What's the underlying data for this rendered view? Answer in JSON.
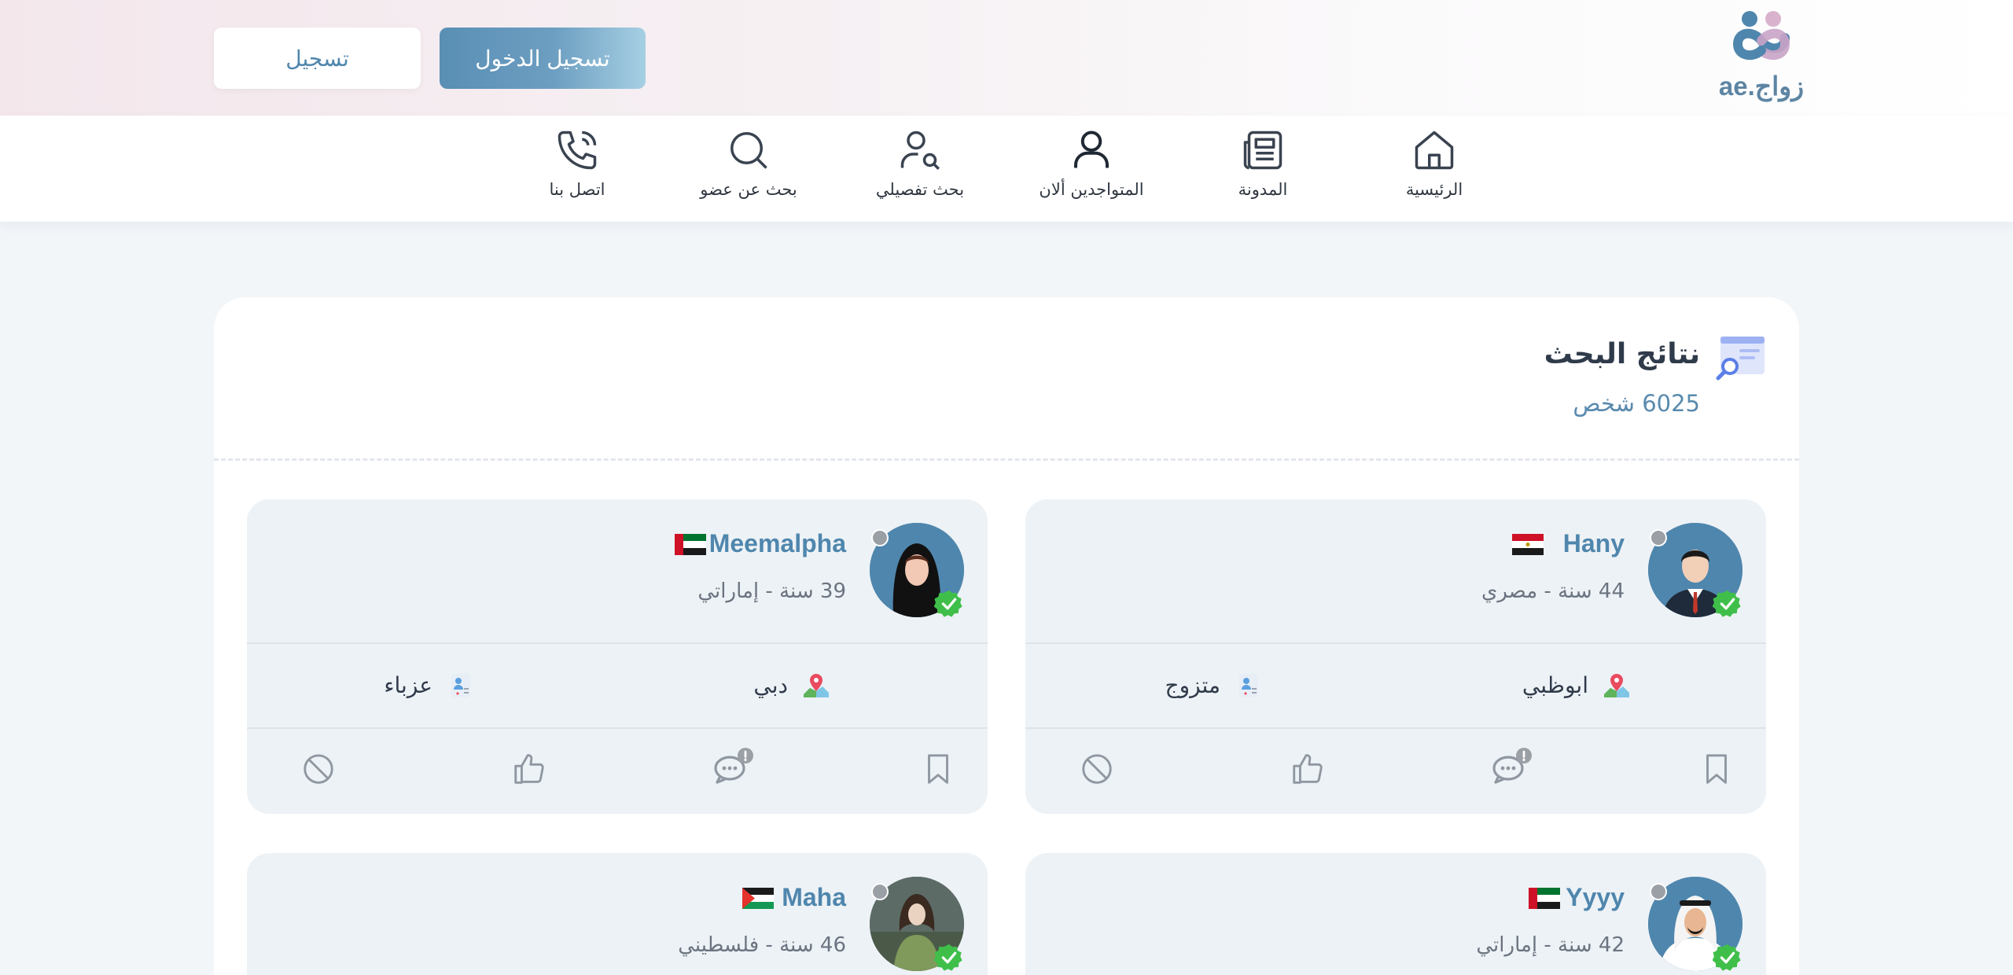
{
  "header": {
    "logo_text": "زواج.ae",
    "login_label": "تسجيل الدخول",
    "register_label": "تسجيل"
  },
  "nav": {
    "items": [
      {
        "label": "الرئيسية",
        "icon": "home-icon"
      },
      {
        "label": "المدونة",
        "icon": "newspaper-icon"
      },
      {
        "label": "المتواجدين ألان",
        "icon": "user-icon"
      },
      {
        "label": "بحث تفصيلي",
        "icon": "user-search-icon"
      },
      {
        "label": "بحث عن عضو",
        "icon": "search-icon"
      },
      {
        "label": "اتصل بنا",
        "icon": "phone-icon"
      }
    ]
  },
  "results": {
    "title": "نتائج البحث",
    "count": "6025 شخص"
  },
  "cards": [
    {
      "name": "Hany",
      "meta": "44 سنة - مصري",
      "city": "ابوظبي",
      "status": "متزوج",
      "flag": "egypt-flag-icon",
      "avatar": "man-suit-avatar"
    },
    {
      "name": "Meemalpha",
      "meta": "39 سنة - إماراتي",
      "city": "دبي",
      "status": "عزباء",
      "flag": "uae-flag-icon",
      "avatar": "woman-hijab-avatar"
    },
    {
      "name": "Yyyy",
      "meta": "42 سنة - إماراتي",
      "city": "",
      "status": "",
      "flag": "uae-flag-icon",
      "avatar": "man-ghutra-avatar"
    },
    {
      "name": "Maha",
      "meta": "46 سنة - فلسطيني",
      "city": "",
      "status": "",
      "flag": "palestine-flag-icon",
      "avatar": "woman-painting-avatar"
    }
  ],
  "colors": {
    "accent": "#4f86ad",
    "card_bg": "#edf2f6",
    "verified": "#3fbf4a"
  }
}
